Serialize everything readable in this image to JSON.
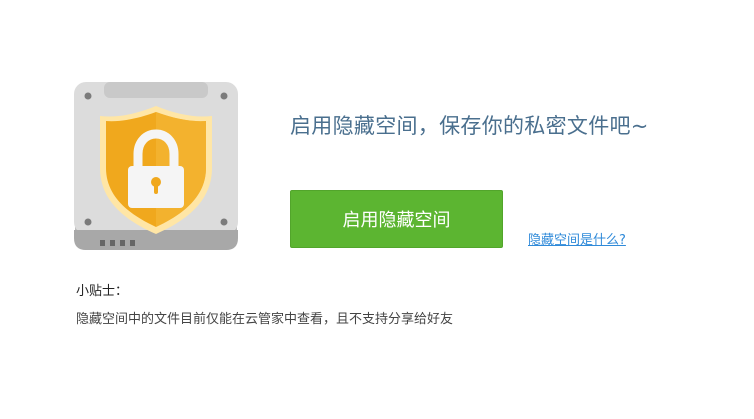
{
  "main": {
    "headline": "启用隐藏空间，保存你的私密文件吧~",
    "enable_button_label": "启用隐藏空间",
    "help_link_text": "隐藏空间是什么?"
  },
  "tips": {
    "title": "小贴士：",
    "body": "隐藏空间中的文件目前仅能在云管家中查看，且不支持分享给好友"
  },
  "icon": {
    "name": "shield-lock-vault-icon",
    "colors": {
      "case": "#d9d9d9",
      "case_bottom": "#a9a9a9",
      "shield": "#f0a81d",
      "shield_border": "#ffe6a6",
      "lock": "#f5f5f5"
    }
  },
  "colors": {
    "headline": "#4a6f8e",
    "button": "#5cb531",
    "link": "#2f8ad9"
  }
}
